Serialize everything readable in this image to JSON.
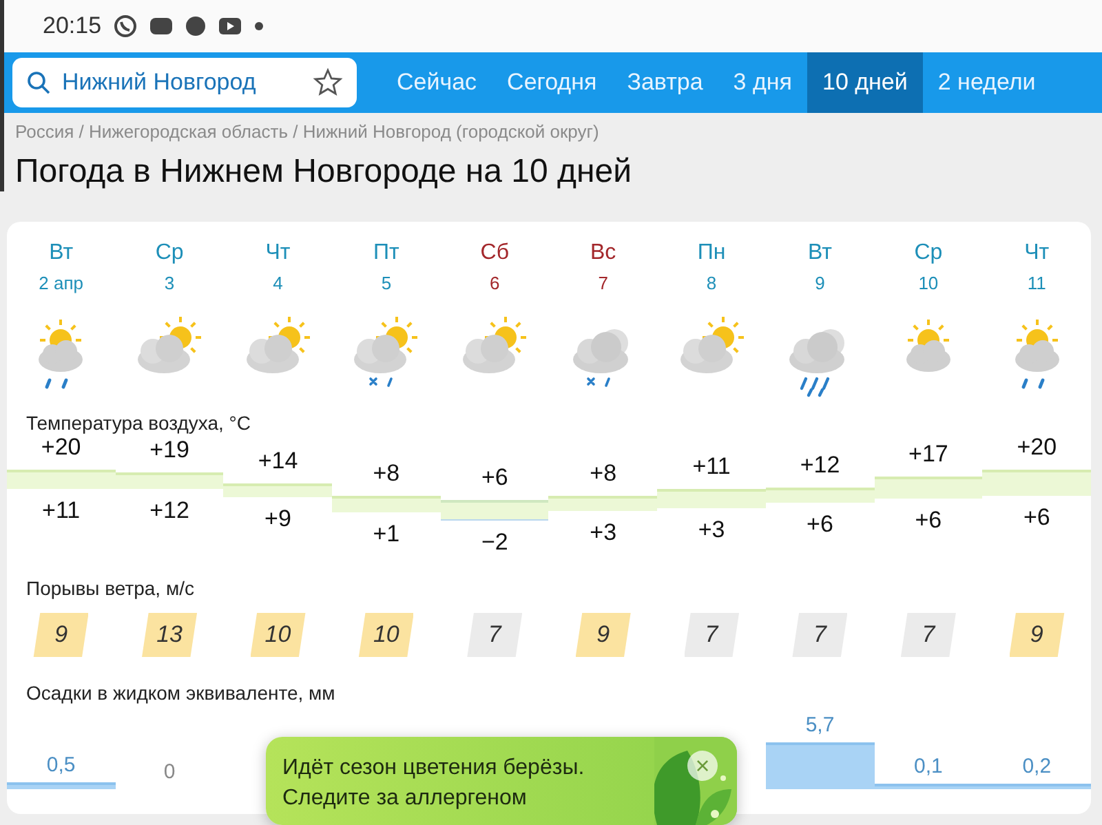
{
  "status_bar": {
    "time": "20:15"
  },
  "header": {
    "search": {
      "value": "Нижний Новгород"
    },
    "tabs": [
      {
        "label": "Сейчас",
        "selected": false
      },
      {
        "label": "Сегодня",
        "selected": false
      },
      {
        "label": "Завтра",
        "selected": false
      },
      {
        "label": "3 дня",
        "selected": false
      },
      {
        "label": "10 дней",
        "selected": true
      },
      {
        "label": "2 недели",
        "selected": false
      }
    ]
  },
  "breadcrumbs": "Россия / Нижегородская область / Нижний Новгород (городской округ)",
  "title": "Погода в Нижнем Новгороде на 10 дней",
  "forecast": {
    "days": [
      {
        "weekday": "Вт",
        "date": "2 апр",
        "weekend": false,
        "kind": "sunshowers"
      },
      {
        "weekday": "Ср",
        "date": "3",
        "weekend": false,
        "kind": "partlycloudy"
      },
      {
        "weekday": "Чт",
        "date": "4",
        "weekend": false,
        "kind": "partlycloudy"
      },
      {
        "weekday": "Пт",
        "date": "5",
        "weekend": false,
        "kind": "partlysleet"
      },
      {
        "weekday": "Сб",
        "date": "6",
        "weekend": true,
        "kind": "partlycloudy"
      },
      {
        "weekday": "Вс",
        "date": "7",
        "weekend": true,
        "kind": "cloudysleet"
      },
      {
        "weekday": "Пн",
        "date": "8",
        "weekend": false,
        "kind": "partlycloudy"
      },
      {
        "weekday": "Вт",
        "date": "9",
        "weekend": false,
        "kind": "cloudyrain"
      },
      {
        "weekday": "Ср",
        "date": "10",
        "weekend": false,
        "kind": "sunnyintervals"
      },
      {
        "weekday": "Чт",
        "date": "11",
        "weekend": false,
        "kind": "sunshowers"
      }
    ],
    "temperature": {
      "label": "Температура воздуха, °C",
      "values": [
        {
          "high": "+20",
          "low": "+11"
        },
        {
          "high": "+19",
          "low": "+12"
        },
        {
          "high": "+14",
          "low": "+9"
        },
        {
          "high": "+8",
          "low": "+1"
        },
        {
          "high": "+6",
          "low": "−2"
        },
        {
          "high": "+8",
          "low": "+3"
        },
        {
          "high": "+11",
          "low": "+3"
        },
        {
          "high": "+12",
          "low": "+6"
        },
        {
          "high": "+17",
          "low": "+6"
        },
        {
          "high": "+20",
          "low": "+6"
        }
      ]
    },
    "wind": {
      "label": "Порывы ветра, м/с",
      "values": [
        {
          "value": "9",
          "color": "#fbe3a0"
        },
        {
          "value": "13",
          "color": "#fbe3a0"
        },
        {
          "value": "10",
          "color": "#fbe3a0"
        },
        {
          "value": "10",
          "color": "#fbe3a0"
        },
        {
          "value": "7",
          "color": "#ebebeb"
        },
        {
          "value": "9",
          "color": "#fbe3a0"
        },
        {
          "value": "7",
          "color": "#ebebeb"
        },
        {
          "value": "7",
          "color": "#ebebeb"
        },
        {
          "value": "7",
          "color": "#ebebeb"
        },
        {
          "value": "9",
          "color": "#fbe3a0"
        }
      ]
    },
    "precipitation": {
      "label": "Осадки в жидком эквиваленте, мм",
      "left_values": [
        "0,5",
        "0"
      ],
      "right_values": [
        "5,7",
        "0,1",
        "0,2"
      ]
    }
  },
  "notice": {
    "text": "Идёт сезон цветения берёзы. Следите за аллергеном",
    "close": "×"
  }
}
